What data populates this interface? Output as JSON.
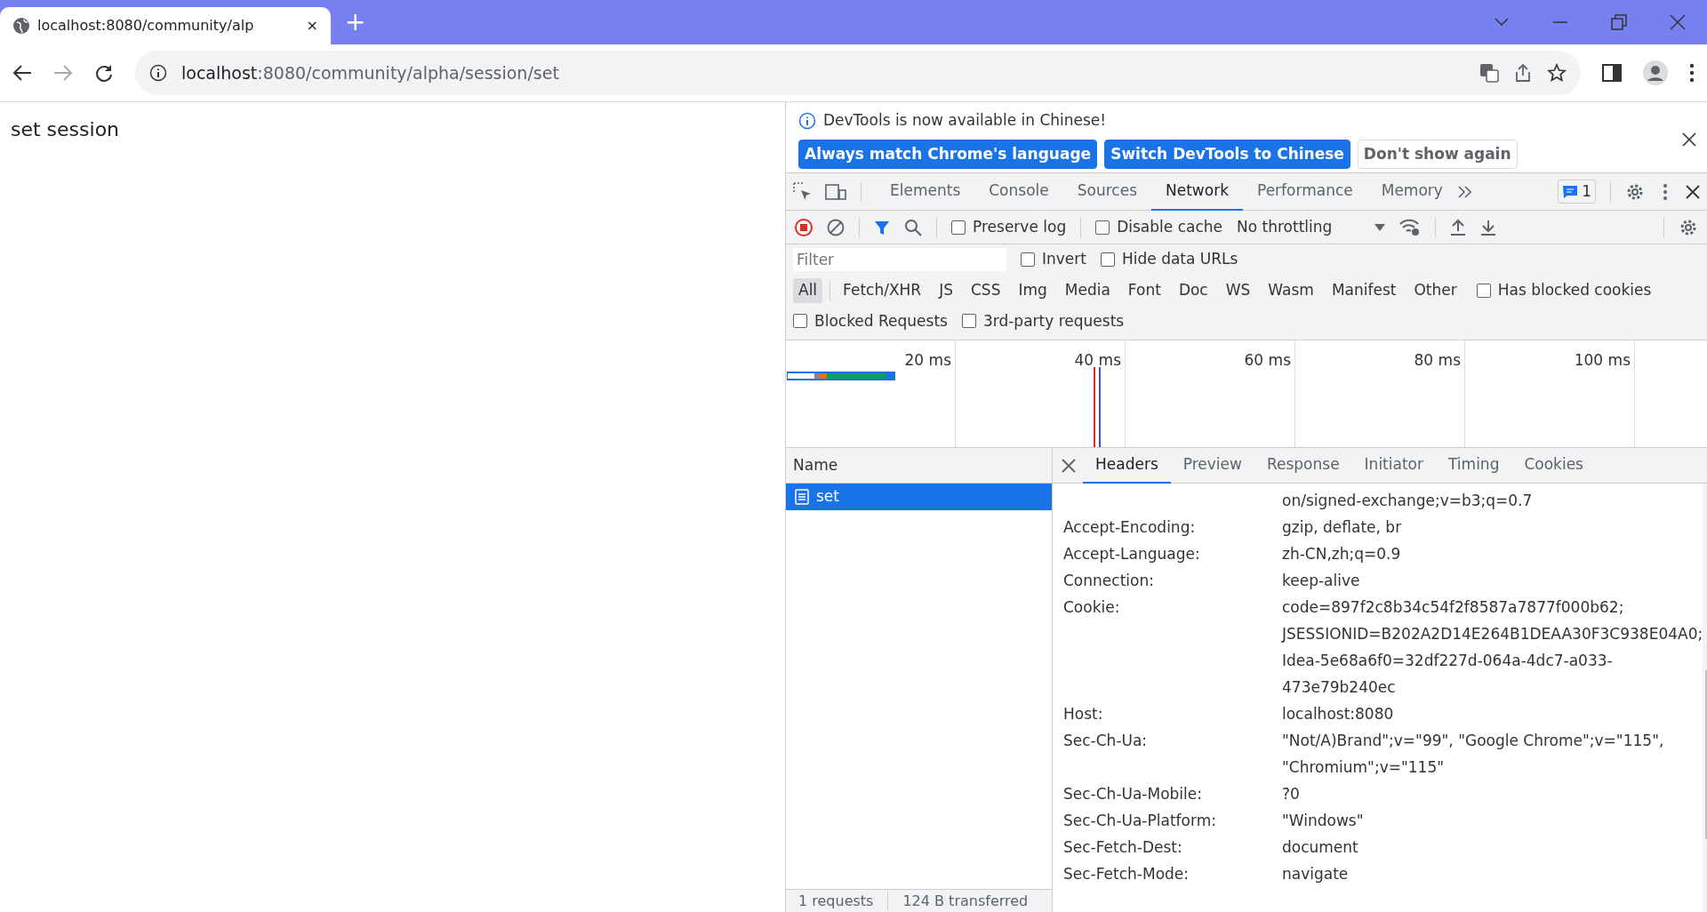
{
  "browser": {
    "tab": {
      "title": "localhost:8080/community/alp",
      "close": "×"
    },
    "new_tab": "+",
    "address": {
      "host": "localhost",
      "path": ":8080/community/alpha/session/set"
    }
  },
  "page": {
    "text": "set session"
  },
  "devtools": {
    "infobar": {
      "message": "DevTools is now available in Chinese!",
      "buttons": [
        {
          "label": "Always match Chrome's language",
          "kind": "primary"
        },
        {
          "label": "Switch DevTools to Chinese",
          "kind": "primary"
        },
        {
          "label": "Don't show again",
          "kind": "secondary"
        }
      ]
    },
    "tabs": [
      {
        "label": "Elements",
        "selected": false
      },
      {
        "label": "Console",
        "selected": false
      },
      {
        "label": "Sources",
        "selected": false
      },
      {
        "label": "Network",
        "selected": true
      },
      {
        "label": "Performance",
        "selected": false
      },
      {
        "label": "Memory",
        "selected": false
      }
    ],
    "issues_count": "1",
    "toolbar": {
      "checkboxes": [
        {
          "label": "Preserve log",
          "checked": false
        },
        {
          "label": "Disable cache",
          "checked": false
        }
      ],
      "throttling": "No throttling"
    },
    "filter": {
      "placeholder": "Filter"
    },
    "filter_options": [
      {
        "label": "Invert",
        "checked": false
      },
      {
        "label": "Hide data URLs",
        "checked": false
      }
    ],
    "types": [
      {
        "label": "All",
        "selected": true
      },
      {
        "label": "Fetch/XHR",
        "selected": false
      },
      {
        "label": "JS",
        "selected": false
      },
      {
        "label": "CSS",
        "selected": false
      },
      {
        "label": "Img",
        "selected": false
      },
      {
        "label": "Media",
        "selected": false
      },
      {
        "label": "Font",
        "selected": false
      },
      {
        "label": "Doc",
        "selected": false
      },
      {
        "label": "WS",
        "selected": false
      },
      {
        "label": "Wasm",
        "selected": false
      },
      {
        "label": "Manifest",
        "selected": false
      },
      {
        "label": "Other",
        "selected": false
      }
    ],
    "has_blocked_cookies": {
      "label": "Has blocked cookies",
      "checked": false
    },
    "more_options": [
      {
        "label": "Blocked Requests",
        "checked": false
      },
      {
        "label": "3rd-party requests",
        "checked": false
      }
    ],
    "timeline_ticks": [
      "20 ms",
      "40 ms",
      "60 ms",
      "80 ms",
      "100 ms"
    ],
    "requests": {
      "column": "Name",
      "rows": [
        {
          "name": "set",
          "selected": true
        }
      ]
    },
    "detail_tabs": [
      {
        "label": "Headers",
        "selected": true
      },
      {
        "label": "Preview",
        "selected": false
      },
      {
        "label": "Response",
        "selected": false
      },
      {
        "label": "Initiator",
        "selected": false
      },
      {
        "label": "Timing",
        "selected": false
      },
      {
        "label": "Cookies",
        "selected": false
      }
    ],
    "headers": [
      {
        "value": [
          "on/signed-exchange;v=b3;q=0.7"
        ]
      },
      {
        "key": "Accept-Encoding:",
        "value": [
          "gzip, deflate, br"
        ]
      },
      {
        "key": "Accept-Language:",
        "value": [
          "zh-CN,zh;q=0.9"
        ]
      },
      {
        "key": "Connection:",
        "value": [
          "keep-alive"
        ]
      },
      {
        "key": "Cookie:",
        "value": [
          "code=897f2c8b34c54f2f8587a7877f000b62;",
          "JSESSIONID=B202A2D14E264B1DEAA30F3C938E04A0;",
          "Idea-5e68a6f0=32df227d-064a-4dc7-a033-",
          "473e79b240ec"
        ]
      },
      {
        "key": "Host:",
        "value": [
          "localhost:8080"
        ]
      },
      {
        "key": "Sec-Ch-Ua:",
        "value": [
          "\"Not/A)Brand\";v=\"99\", \"Google Chrome\";v=\"115\",",
          "\"Chromium\";v=\"115\""
        ]
      },
      {
        "key": "Sec-Ch-Ua-Mobile:",
        "value": [
          "?0"
        ]
      },
      {
        "key": "Sec-Ch-Ua-Platform:",
        "value": [
          "\"Windows\""
        ]
      },
      {
        "key": "Sec-Fetch-Dest:",
        "value": [
          "document"
        ]
      },
      {
        "key": "Sec-Fetch-Mode:",
        "value": [
          "navigate"
        ]
      }
    ],
    "status": [
      "1 requests",
      "124 B transferred"
    ]
  }
}
